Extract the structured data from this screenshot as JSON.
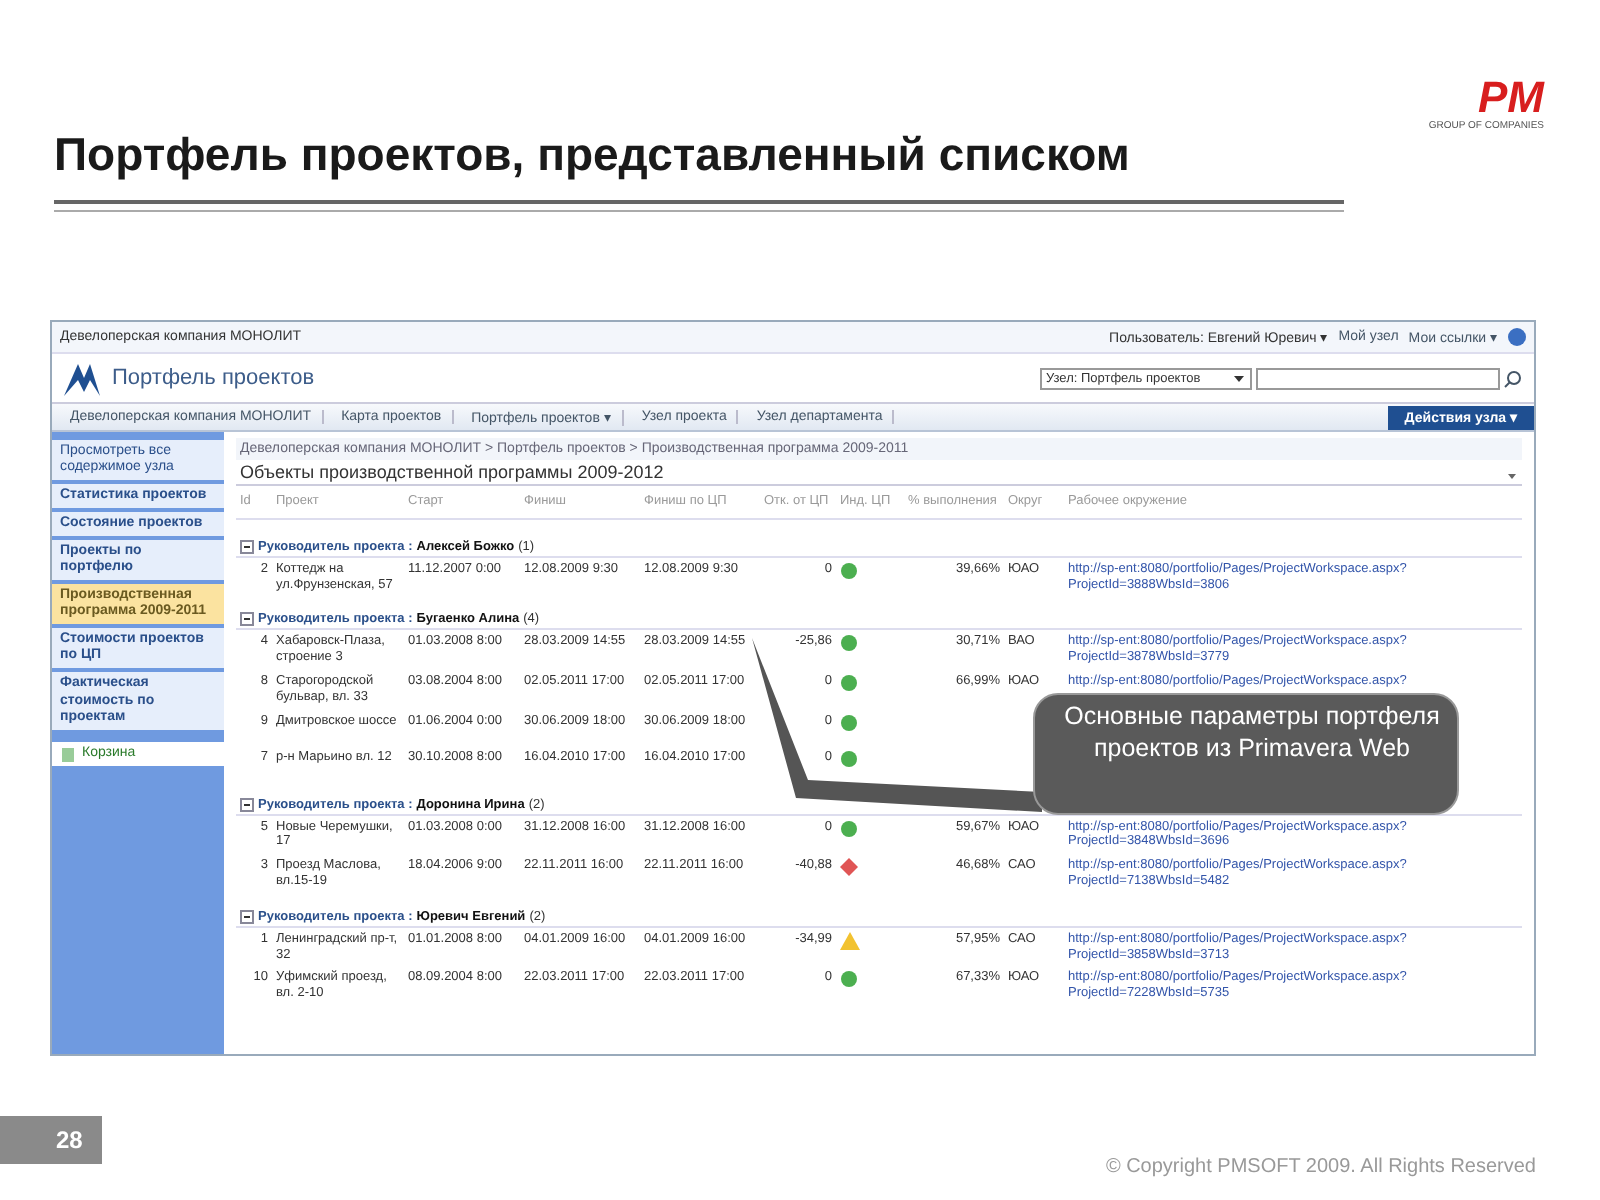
{
  "slide": {
    "title": "Портфель проектов, представленный списком",
    "logo": {
      "mark": "PM",
      "subtitle": "GROUP OF COMPANIES"
    },
    "page_number": "28",
    "copyright": "© Copyright PMSOFT 2009. All Rights Reserved"
  },
  "site": {
    "top_bar": {
      "company": "Девелоперская компания МОНОЛИТ",
      "user": "Пользователь: Евгений Юревич ▾",
      "links": [
        "Мой узел",
        "Мои ссылки ▾"
      ]
    },
    "title": "Портфель проектов",
    "scope": "Узел: Портфель проектов",
    "nav": [
      {
        "label": "Девелоперская компания МОНОЛИТ"
      },
      {
        "label": "Карта проектов"
      },
      {
        "label": "Портфель проектов ▾"
      },
      {
        "label": "Узел проекта"
      },
      {
        "label": "Узел департамента"
      }
    ],
    "actions": "Действия узла ▾",
    "sidebar": [
      {
        "label": "Просмотреть все содержимое узла",
        "kind": "plain",
        "selected": false
      },
      {
        "label": "Статистика проектов",
        "kind": "link",
        "selected": false
      },
      {
        "label": "Состояние проектов",
        "kind": "link",
        "selected": false
      },
      {
        "label": "Проекты по портфелю",
        "kind": "link",
        "selected": false
      },
      {
        "label": "Производственная программа 2009-2011",
        "kind": "link",
        "selected": true
      },
      {
        "label": "Стоимости проектов по ЦП",
        "kind": "link",
        "selected": false
      },
      {
        "label": "Фактическая стоимость по проектам",
        "kind": "link",
        "selected": false
      },
      {
        "label": "Корзина",
        "kind": "bin",
        "selected": false
      }
    ],
    "breadcrumb": "Девелоперская компания МОНОЛИТ > Портфель проектов > Производственная программа 2009-2011",
    "list_title": "Объекты производственной программы 2009-2012",
    "columns": [
      "Id",
      "Проект",
      "Старт",
      "Финиш",
      "Финиш по ЦП",
      "Отк. от ЦП",
      "Инд. ЦП",
      "% выполнения",
      "Округ",
      "Рабочее окружение"
    ],
    "groups": [
      {
        "label": "Руководитель проекта :",
        "name": "Алексей Божко",
        "count": "(1)",
        "expanded": true,
        "rows": [
          {
            "id": "2",
            "project": "Коттедж на ул.Фрунзенская, 57",
            "start": "11.12.2007 0:00",
            "finish": "12.08.2009 9:30",
            "baseline_finish": "12.08.2009 9:30",
            "deviation": "0",
            "indicator": {
              "kind": "circle",
              "color": "#4caf50"
            },
            "percent": "39,66%",
            "district": "ЮАО",
            "url": "http://sp-ent:8080/portfolio/Pages/ProjectWorkspace.aspx?ProjectId=3888WbsId=3806"
          }
        ]
      },
      {
        "label": "Руководитель проекта :",
        "name": "Бугаенко Алина",
        "count": "(4)",
        "expanded": true,
        "rows": [
          {
            "id": "4",
            "project": "Хабаровск-Плаза, строение 3",
            "start": "01.03.2008 8:00",
            "finish": "28.03.2009 14:55",
            "baseline_finish": "28.03.2009 14:55",
            "deviation": "-25,86",
            "indicator": {
              "kind": "circle",
              "color": "#4caf50"
            },
            "percent": "30,71%",
            "district": "ВАО",
            "url": "http://sp-ent:8080/portfolio/Pages/ProjectWorkspace.aspx?ProjectId=3878WbsId=3779"
          },
          {
            "id": "8",
            "project": "Старогородской бульвар, вл. 33",
            "start": "03.08.2004 8:00",
            "finish": "02.05.2011 17:00",
            "baseline_finish": "02.05.2011 17:00",
            "deviation": "0",
            "indicator": {
              "kind": "circle",
              "color": "#4caf50"
            },
            "percent": "66,99%",
            "district": "ЮАО",
            "url": "http://sp-ent:8080/portfolio/Pages/ProjectWorkspace.aspx?"
          },
          {
            "id": "9",
            "project": "Дмитровское шоссе",
            "start": "01.06.2004 0:00",
            "finish": "30.06.2009 18:00",
            "baseline_finish": "30.06.2009 18:00",
            "deviation": "0",
            "indicator": {
              "kind": "circle",
              "color": "#4caf50"
            }
          },
          {
            "id": "7",
            "project": "р-н Марьино вл. 12",
            "start": "30.10.2008 8:00",
            "finish": "16.04.2010 17:00",
            "baseline_finish": "16.04.2010 17:00",
            "deviation": "0",
            "indicator": {
              "kind": "circle",
              "color": "#4caf50"
            }
          }
        ]
      },
      {
        "label": "Руководитель проекта :",
        "name": "Доронина Ирина",
        "count": "(2)",
        "expanded": true,
        "rows": [
          {
            "id": "5",
            "project": "Новые Черемушки, 17",
            "start": "01.03.2008 0:00",
            "finish": "31.12.2008 16:00",
            "baseline_finish": "31.12.2008 16:00",
            "deviation": "0",
            "indicator": {
              "kind": "circle",
              "color": "#4caf50"
            },
            "percent": "59,67%",
            "district": "ЮАО",
            "url": "http://sp-ent:8080/portfolio/Pages/ProjectWorkspace.aspx?ProjectId=3848WbsId=3696"
          },
          {
            "id": "3",
            "project": "Проезд Маслова, вл.15-19",
            "start": "18.04.2006 9:00",
            "finish": "22.11.2011 16:00",
            "baseline_finish": "22.11.2011 16:00",
            "deviation": "-40,88",
            "indicator": {
              "kind": "diamond",
              "color": "#e05555"
            },
            "percent": "46,68%",
            "district": "САО",
            "url": "http://sp-ent:8080/portfolio/Pages/ProjectWorkspace.aspx?ProjectId=7138WbsId=5482"
          }
        ]
      },
      {
        "label": "Руководитель проекта :",
        "name": "Юревич Евгений",
        "count": "(2)",
        "expanded": true,
        "rows": [
          {
            "id": "1",
            "project": "Ленинградский пр-т, 32",
            "start": "01.01.2008 8:00",
            "finish": "04.01.2009 16:00",
            "baseline_finish": "04.01.2009 16:00",
            "deviation": "-34,99",
            "indicator": {
              "kind": "triangle",
              "color": "#f2c230"
            },
            "percent": "57,95%",
            "district": "САО",
            "url": "http://sp-ent:8080/portfolio/Pages/ProjectWorkspace.aspx?ProjectId=3858WbsId=3713"
          },
          {
            "id": "10",
            "project": "Уфимский проезд, вл. 2-10",
            "start": "08.09.2004 8:00",
            "finish": "22.03.2011 17:00",
            "baseline_finish": "22.03.2011 17:00",
            "deviation": "0",
            "indicator": {
              "kind": "circle",
              "color": "#4caf50"
            },
            "percent": "67,33%",
            "district": "ЮАО",
            "url": "http://sp-ent:8080/portfolio/Pages/ProjectWorkspace.aspx?ProjectId=7228WbsId=5735"
          }
        ]
      }
    ]
  },
  "callout": "Основные параметры портфеля проектов из Primavera Web"
}
